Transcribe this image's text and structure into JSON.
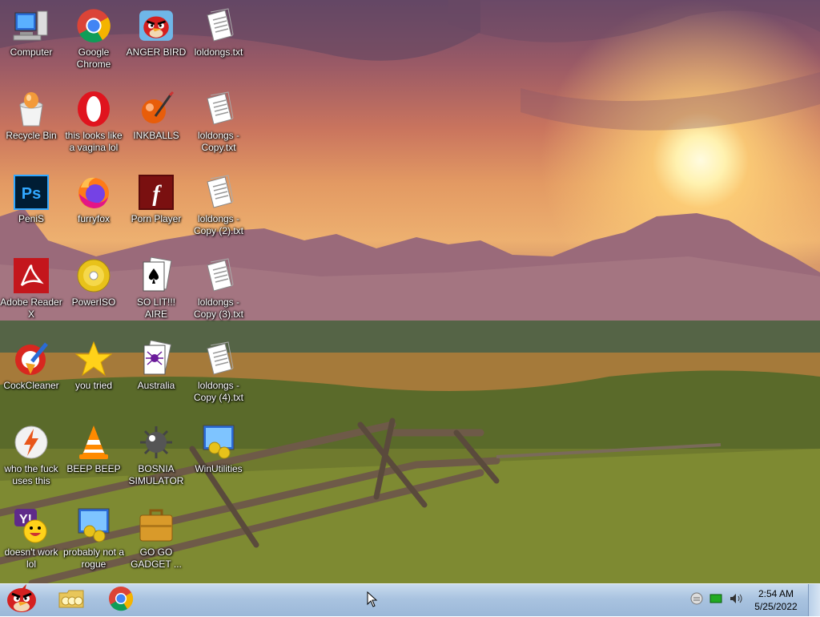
{
  "desktop": {
    "icons": [
      {
        "label": "Computer",
        "icon": "computer-icon"
      },
      {
        "label": "Google Chrome",
        "icon": "chrome-icon"
      },
      {
        "label": "ANGER BIRD",
        "icon": "angry-bird-icon"
      },
      {
        "label": "loldongs.txt",
        "icon": "text-file-icon"
      },
      {
        "label": "Recycle Bin",
        "icon": "recycle-bin-icon"
      },
      {
        "label": "this looks like a vagina lol",
        "icon": "opera-icon"
      },
      {
        "label": "INKBALLS",
        "icon": "inkball-icon"
      },
      {
        "label": "loldongs - Copy.txt",
        "icon": "text-file-icon"
      },
      {
        "label": "PeniS",
        "icon": "photoshop-icon"
      },
      {
        "label": "furryfox",
        "icon": "firefox-icon"
      },
      {
        "label": "Porn Player",
        "icon": "flash-icon"
      },
      {
        "label": "loldongs - Copy (2).txt",
        "icon": "text-file-icon"
      },
      {
        "label": "Adobe Reader X",
        "icon": "adobe-reader-icon"
      },
      {
        "label": "PowerISO",
        "icon": "poweriso-icon"
      },
      {
        "label": "SO LIT!!! AIRE",
        "icon": "solitaire-icon"
      },
      {
        "label": "loldongs - Copy (3).txt",
        "icon": "text-file-icon"
      },
      {
        "label": "CockCleaner",
        "icon": "ccleaner-icon"
      },
      {
        "label": "you tried",
        "icon": "star-icon"
      },
      {
        "label": "Australia",
        "icon": "spider-solitaire-icon"
      },
      {
        "label": "loldongs - Copy (4).txt",
        "icon": "text-file-icon"
      },
      {
        "label": "who the fuck uses this",
        "icon": "lightning-icon"
      },
      {
        "label": "BEEP BEEP",
        "icon": "vlc-icon"
      },
      {
        "label": "BOSNIA SIMULATOR",
        "icon": "minesweeper-icon"
      },
      {
        "label": "WinUtilities",
        "icon": "winutilities-icon"
      },
      {
        "label": "doesn't work lol",
        "icon": "yahoo-messenger-icon"
      },
      {
        "label": "probably not a rogue",
        "icon": "winutilities-icon"
      },
      {
        "label": "GO GO GADGET ...",
        "icon": "briefcase-icon"
      }
    ]
  },
  "taskbar": {
    "start_icon": "angry-bird-icon",
    "pinned": [
      {
        "icon": "explorer-folder-icon"
      },
      {
        "icon": "chrome-icon"
      }
    ],
    "tray": [
      {
        "icon": "messenger-tray-icon"
      },
      {
        "icon": "network-icon"
      },
      {
        "icon": "volume-icon"
      }
    ],
    "time": "2:54 AM",
    "date": "5/25/2022"
  }
}
